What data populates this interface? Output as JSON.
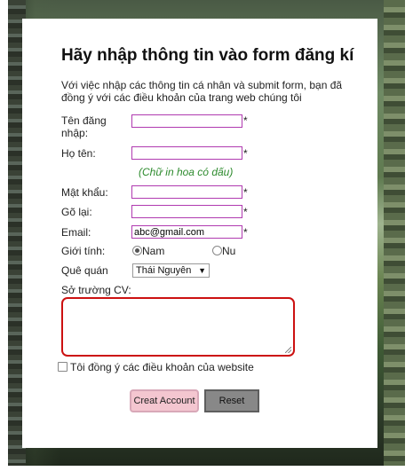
{
  "form": {
    "title": "Hãy nhập thông tin vào form đăng kí",
    "intro": "Với việc nhập các thông tin cá nhân và submit form, bạn đã đồng ý với các điều khoản của trang web chúng tôi",
    "username_label": "Tên đăng nhập:",
    "fullname_label": "Họ tên:",
    "fullname_hint": "(Chữ in hoa có dấu)",
    "password_label": "Mật khẩu:",
    "retype_label": "Gõ lại:",
    "email_label": "Email:",
    "email_value": "abc@gmail.com",
    "gender_label": "Giới tính:",
    "gender_options": [
      "Nam",
      "Nu"
    ],
    "gender_selected": "Nam",
    "hometown_label": "Quê quán",
    "hometown_value": "Thái Nguyên",
    "cv_label": "Sở trường CV:",
    "agree_label": "Tôi đồng ý các điều khoản của website",
    "required_mark": "*",
    "create_button": "Creat Account",
    "reset_button": "Reset"
  }
}
